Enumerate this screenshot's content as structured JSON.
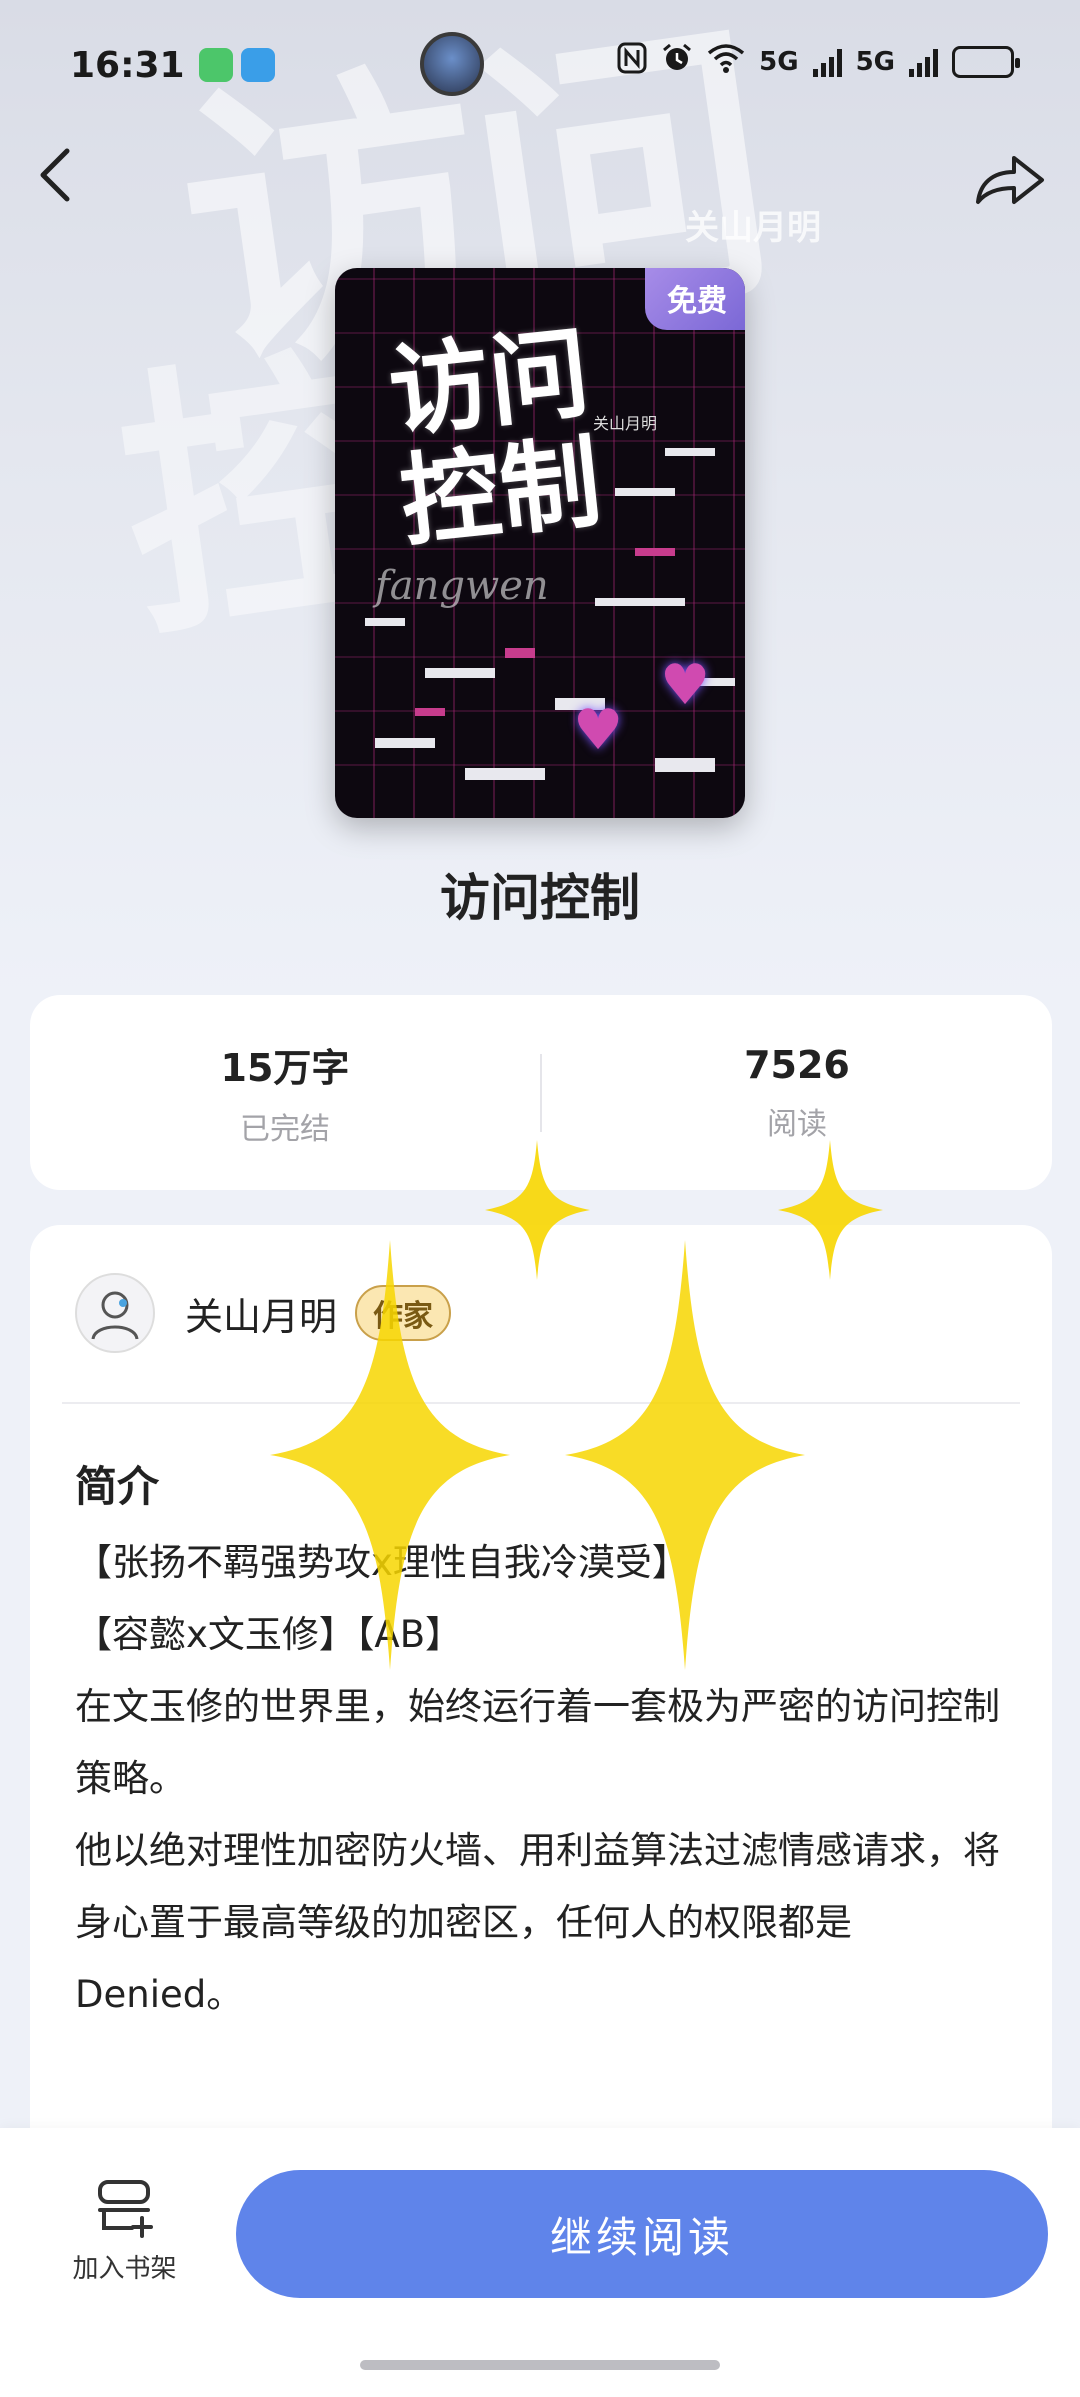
{
  "status_bar": {
    "time": "16:31",
    "network_left": "5G",
    "network_right": "5G",
    "battery_level": 0.45
  },
  "header": {
    "back_icon": "chevron-left-icon",
    "share_icon": "share-arrow-icon"
  },
  "background": {
    "glyphs_top": "访问",
    "glyphs_bottom": "控制",
    "author_watermark": "关山月明"
  },
  "cover": {
    "badge": "免费",
    "title_line1": "访问",
    "title_line2": "控制",
    "author": "关山月明",
    "script": "fangwen"
  },
  "book": {
    "title": "访问控制"
  },
  "stats": [
    {
      "value": "15万字",
      "label": "已完结"
    },
    {
      "value": "7526",
      "label": "阅读"
    }
  ],
  "author": {
    "name": "关山月明",
    "badge": "作家"
  },
  "intro": {
    "heading": "简介",
    "paragraphs": [
      "【张扬不羁强势攻x理性自我冷漠受】",
      "【容懿x文玉修】【AB】",
      "",
      "在文玉修的世界里，始终运行着一套极为严密的访问控制策略。",
      "他以绝对理性加密防火墙、用利益算法过滤情感请求，将身心置于最高等级的加密区，任何人的权限都是Denied。"
    ]
  },
  "bottom_bar": {
    "shelf_label": "加入书架",
    "continue_label": "继续阅读"
  },
  "colors": {
    "accent": "#5f84ea",
    "badge_gold": "#fbe7b2",
    "free_badge": "#8f7ae0"
  }
}
